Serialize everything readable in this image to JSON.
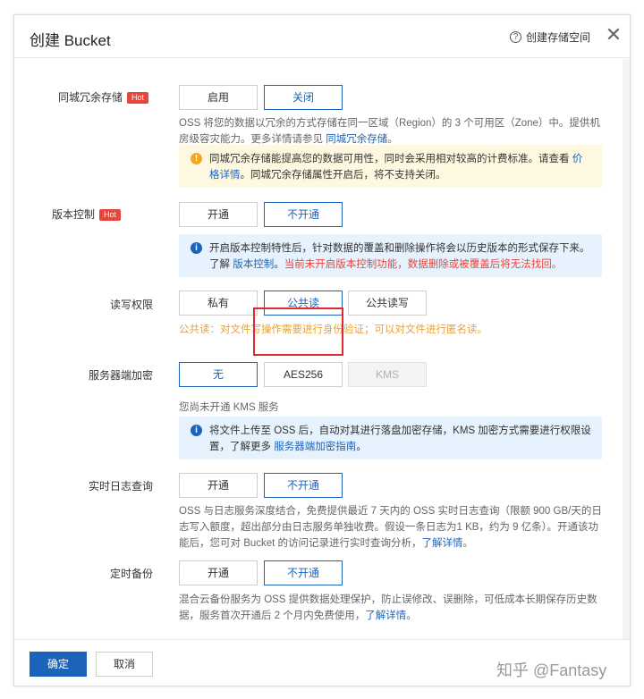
{
  "dialog": {
    "title": "创建 Bucket",
    "help_label": "创建存储空间",
    "help_icon": "question-circle-icon",
    "close_icon": "close-x-icon"
  },
  "hot_badge": "Hot",
  "sections": {
    "redundancy": {
      "label": "同城冗余存储",
      "options": [
        "启用",
        "关闭"
      ],
      "selected": "关闭",
      "desc_pre": "OSS 将您的数据以冗余的方式存储在同一区域（Region）的 3 个可用区（Zone）中。提供机房级容灾能力。更多详情请参见 ",
      "desc_link": "同城冗余存储",
      "desc_post": "。",
      "notice_pre": "同城冗余存储能提高您的数据可用性，同时会采用相对较高的计费标准。请查看 ",
      "notice_link": "价格详情",
      "notice_post": "。同城冗余存储属性开启后，将不支持关闭。"
    },
    "versioning": {
      "label": "版本控制",
      "options": [
        "开通",
        "不开通"
      ],
      "selected": "不开通",
      "notice_pre": "开启版本控制特性后，针对数据的覆盖和删除操作将会以历史版本的形式保存下来。了解 ",
      "notice_link": "版本控制",
      "notice_mid": "。",
      "notice_red": "当前未开启版本控制功能，数据删除或被覆盖后将无法找回。"
    },
    "acl": {
      "label": "读写权限",
      "options": [
        "私有",
        "公共读",
        "公共读写"
      ],
      "selected": "公共读",
      "warning": "公共读：对文件写操作需要进行身份验证；可以对文件进行匿名读。"
    },
    "encryption": {
      "label": "服务器端加密",
      "options": [
        "无",
        "AES256",
        "KMS"
      ],
      "selected": "无",
      "disabled": "KMS",
      "status": "您尚未开通 KMS 服务",
      "notice_pre": "将文件上传至 OSS 后，自动对其进行落盘加密存储，KMS 加密方式需要进行权限设置，了解更多 ",
      "notice_link": "服务器端加密指南",
      "notice_post": "。"
    },
    "realtime_log": {
      "label": "实时日志查询",
      "options": [
        "开通",
        "不开通"
      ],
      "selected": "不开通",
      "desc_pre": "OSS 与日志服务深度结合，免费提供最近 7 天内的 OSS 实时日志查询（限额 900 GB/天的日志写入额度，超出部分由日志服务单独收费。假设一条日志为1 KB，约为 9 亿条）。开通该功能后，您可对 Bucket 的访问记录进行实时查询分析，",
      "desc_link": "了解详情",
      "desc_post": "。"
    },
    "backup": {
      "label": "定时备份",
      "options": [
        "开通",
        "不开通"
      ],
      "selected": "不开通",
      "desc_pre": "混合云备份服务为 OSS 提供数据处理保护，防止误修改、误删除，可低成本长期保存历史数据，服务首次开通后 2 个月内免费使用，",
      "desc_link": "了解详情",
      "desc_post": "。"
    }
  },
  "footer": {
    "confirm": "确定",
    "cancel": "取消"
  },
  "watermark": "知乎 @Fantasy",
  "colors": {
    "primary": "#1c64bb",
    "hot": "#e8453c",
    "warning": "#e6a23c",
    "highlight": "#e0262f"
  }
}
